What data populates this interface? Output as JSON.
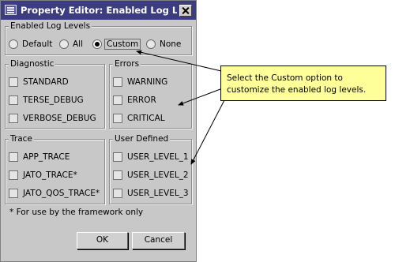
{
  "window": {
    "title": "Property Editor: Enabled Log Levels"
  },
  "enabled_levels": {
    "label": "Enabled Log Levels",
    "options": [
      {
        "label": "Default",
        "selected": false
      },
      {
        "label": "All",
        "selected": false
      },
      {
        "label": "Custom",
        "selected": true
      },
      {
        "label": "None",
        "selected": false
      }
    ]
  },
  "groups": {
    "diagnostic": {
      "label": "Diagnostic",
      "items": [
        "STANDARD",
        "TERSE_DEBUG",
        "VERBOSE_DEBUG"
      ]
    },
    "errors": {
      "label": "Errors",
      "items": [
        "WARNING",
        "ERROR",
        "CRITICAL"
      ]
    },
    "trace": {
      "label": "Trace",
      "items": [
        "APP_TRACE",
        "JATO_TRACE*",
        "JATO_QOS_TRACE*"
      ]
    },
    "user_defined": {
      "label": "User Defined",
      "items": [
        "USER_LEVEL_1",
        "USER_LEVEL_2",
        "USER_LEVEL_3"
      ]
    }
  },
  "footnote": "* For use by the framework only",
  "buttons": {
    "ok": "OK",
    "cancel": "Cancel"
  },
  "callout": {
    "text": "Select the Custom option to customize the enabled log levels."
  },
  "colors": {
    "titlebar": "#3c3c82",
    "dialog_bg": "#c8c8c8",
    "callout_bg": "#ffff99"
  }
}
